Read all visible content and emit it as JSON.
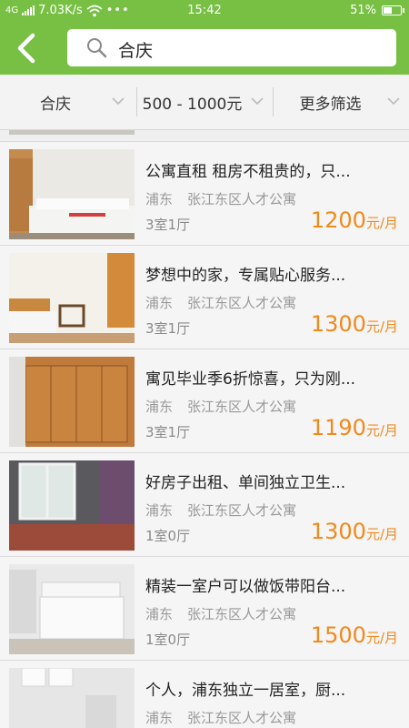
{
  "status": {
    "network": "4G",
    "speed": "7.03K/s",
    "time": "15:42",
    "battery": "51%",
    "battery_level": 0.51
  },
  "search": {
    "value": "合庆"
  },
  "filters": [
    {
      "label": "合庆"
    },
    {
      "label": "500 - 1000元"
    },
    {
      "label": "更多筛选"
    }
  ],
  "listings": [
    {
      "title": "公寓直租 租房不租贵的，只...",
      "district": "浦东",
      "community": "张江东区人才公寓",
      "rooms": "3室1厅",
      "price": "1200",
      "unit": "元/月"
    },
    {
      "title": "梦想中的家，专属贴心服务...",
      "district": "浦东",
      "community": "张江东区人才公寓",
      "rooms": "3室1厅",
      "price": "1300",
      "unit": "元/月"
    },
    {
      "title": "寓见毕业季6折惊喜，只为刚...",
      "district": "浦东",
      "community": "张江东区人才公寓",
      "rooms": "3室1厅",
      "price": "1190",
      "unit": "元/月"
    },
    {
      "title": "好房子出租、单间独立卫生...",
      "district": "浦东",
      "community": "张江东区人才公寓",
      "rooms": "1室0厅",
      "price": "1300",
      "unit": "元/月"
    },
    {
      "title": "精装一室户可以做饭带阳台...",
      "district": "浦东",
      "community": "张江东区人才公寓",
      "rooms": "1室0厅",
      "price": "1500",
      "unit": "元/月"
    },
    {
      "title": "个人，浦东独立一居室，厨...",
      "district": "浦东",
      "community": "张江东区人才公寓",
      "rooms": "",
      "price": "",
      "unit": ""
    }
  ],
  "colors": {
    "accent": "#77c043",
    "price": "#f08a1c"
  }
}
